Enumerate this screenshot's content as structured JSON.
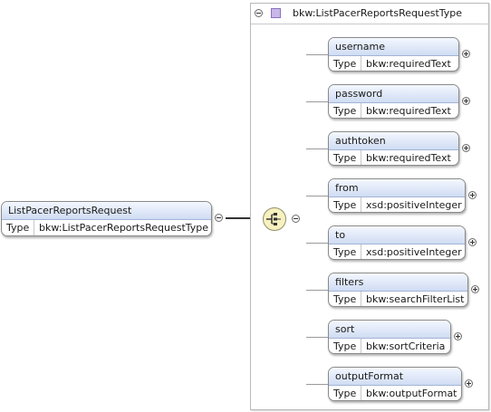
{
  "root": {
    "name": "ListPacerReportsRequest",
    "type_label": "Type",
    "type_value": "bkw:ListPacerReportsRequestType"
  },
  "complex_type": {
    "name": "bkw:ListPacerReportsRequestType"
  },
  "children": [
    {
      "name": "username",
      "type_label": "Type",
      "type_value": "bkw:requiredText"
    },
    {
      "name": "password",
      "type_label": "Type",
      "type_value": "bkw:requiredText"
    },
    {
      "name": "authtoken",
      "type_label": "Type",
      "type_value": "bkw:requiredText"
    },
    {
      "name": "from",
      "type_label": "Type",
      "type_value": "xsd:positiveInteger"
    },
    {
      "name": "to",
      "type_label": "Type",
      "type_value": "xsd:positiveInteger"
    },
    {
      "name": "filters",
      "type_label": "Type",
      "type_value": "bkw:searchFilterList"
    },
    {
      "name": "sort",
      "type_label": "Type",
      "type_value": "bkw:sortCriteria"
    },
    {
      "name": "outputFormat",
      "type_label": "Type",
      "type_value": "bkw:outputFormat"
    }
  ]
}
